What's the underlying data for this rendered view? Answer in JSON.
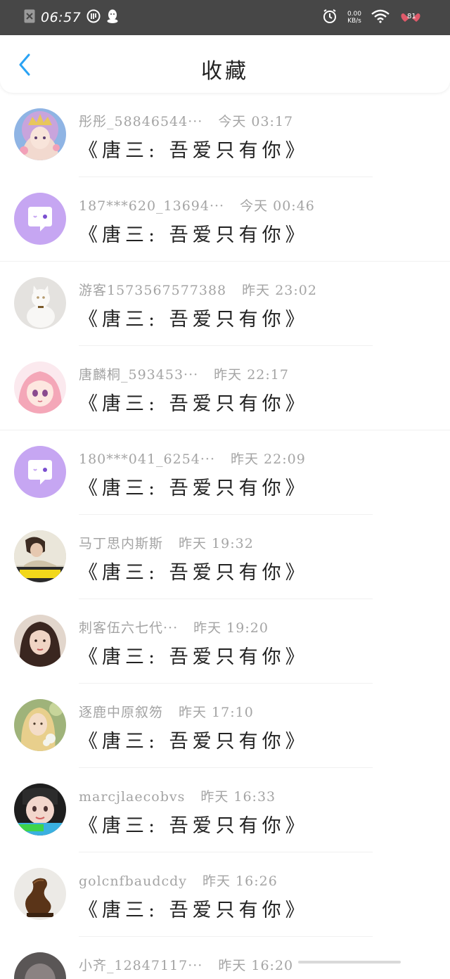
{
  "status_bar": {
    "time": "06:57",
    "net_speed_value": "0.00",
    "net_speed_unit": "KB/s",
    "battery": "81",
    "icons": [
      "close-box-icon",
      "translate-icon",
      "qq-penguin-icon",
      "alarm-icon",
      "wifi-icon",
      "battery-icon"
    ]
  },
  "header": {
    "title": "收藏",
    "back_icon": "chevron-left-icon"
  },
  "colors": {
    "accent": "#2aa3f4",
    "status_bg": "#474747",
    "meta_text": "#a4a4a4",
    "message_text": "#222222"
  },
  "items": [
    {
      "name": "彤彤_58846544···",
      "time": "今天 03:17",
      "message": "《唐三: 吾爱只有你》",
      "avatar": "anime-girl-crown"
    },
    {
      "name": "187***620_13694···",
      "time": "今天 00:46",
      "message": "《唐三: 吾爱只有你》",
      "avatar": "default-chat-bubble"
    },
    {
      "name": "游客1573567577388",
      "time": "昨天 23:02",
      "message": "《唐三: 吾爱只有你》",
      "avatar": "white-cat"
    },
    {
      "name": "唐麟桐_593453···",
      "time": "昨天 22:17",
      "message": "《唐三: 吾爱只有你》",
      "avatar": "pink-hair-anime"
    },
    {
      "name": "180***041_6254···",
      "time": "昨天 22:09",
      "message": "《唐三: 吾爱只有你》",
      "avatar": "default-chat-bubble"
    },
    {
      "name": "马丁思内斯斯",
      "time": "昨天 19:32",
      "message": "《唐三: 吾爱只有你》",
      "avatar": "boy-photo"
    },
    {
      "name": "刺客伍六七代···",
      "time": "昨天 19:20",
      "message": "《唐三: 吾爱只有你》",
      "avatar": "girl-portrait"
    },
    {
      "name": "逐鹿中原叙笏",
      "time": "昨天 17:10",
      "message": "《唐三: 吾爱只有你》",
      "avatar": "blonde-girl"
    },
    {
      "name": "marcjlaecobvs",
      "time": "昨天 16:33",
      "message": "《唐三: 吾爱只有你》",
      "avatar": "cartoon-face"
    },
    {
      "name": "golcnfbaudcdy",
      "time": "昨天 16:26",
      "message": "《唐三: 吾爱只有你》",
      "avatar": "bronze-sculpture"
    },
    {
      "name": "小齐_12847117···",
      "time": "昨天 16:20",
      "message": "",
      "avatar": "partial-photo"
    }
  ]
}
